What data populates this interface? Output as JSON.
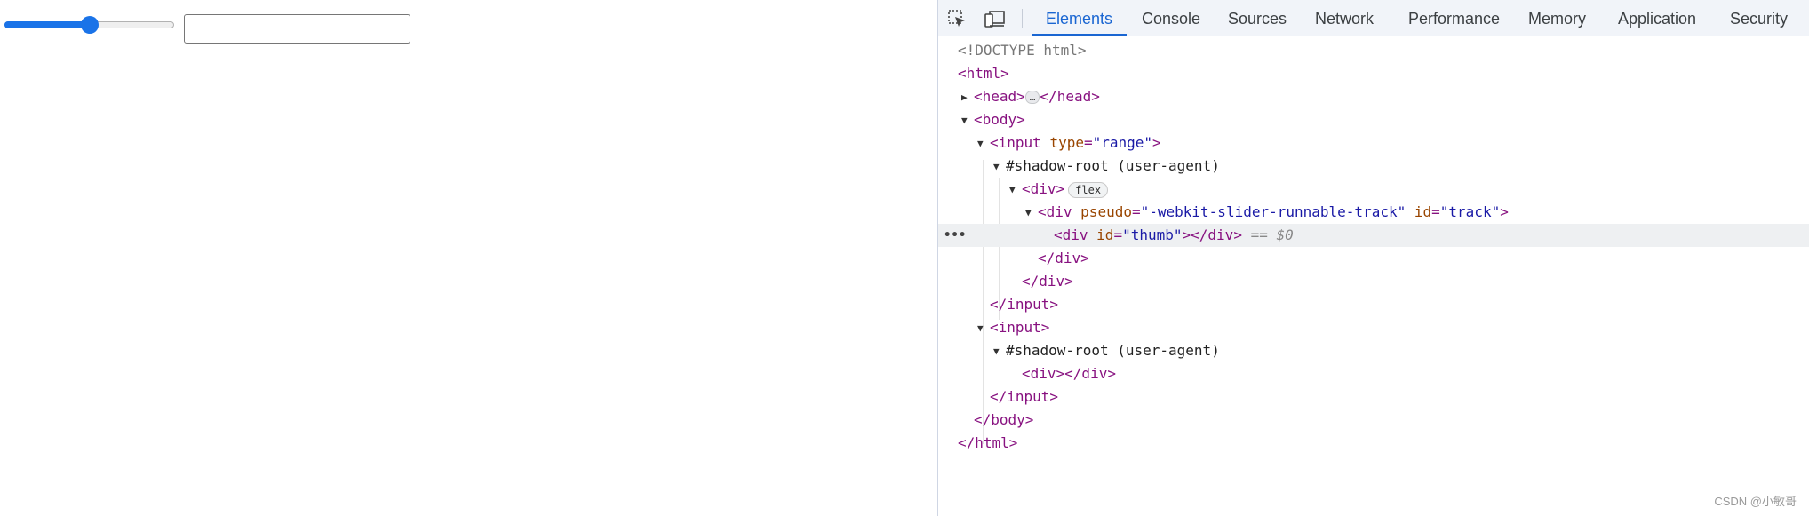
{
  "page": {
    "slider": {
      "value": 0.5
    }
  },
  "devtools": {
    "tabs": [
      "Elements",
      "Console",
      "Sources",
      "Network",
      "Performance",
      "Memory",
      "Application",
      "Security"
    ],
    "active_tab": "Elements",
    "tree": {
      "doctype": "<!DOCTYPE html>",
      "html_open": "<html>",
      "head_open": "<head>",
      "ellipsis": "…",
      "head_close": "</head>",
      "body_open": "<body>",
      "input_open": "<input",
      "type_attr": "type",
      "type_value": "\"range\"",
      "shadow_root": "#shadow-root (user-agent)",
      "div_open": "<div>",
      "flex_badge": "flex",
      "track_div_open": "<div",
      "pseudo_attr": "pseudo",
      "pseudo_value": "\"-webkit-slider-runnable-track\"",
      "id_attr": "id",
      "track_value": "\"track\"",
      "thumb_value": "\"thumb\"",
      "div_close": "</div>",
      "selected_marker": "== $0",
      "input_close": "</input>",
      "input_plain": "<input>",
      "empty_div": "<div></div>",
      "body_close": "</body>",
      "html_close": "</html>",
      "row_dots": "•••"
    },
    "watermark": "CSDN @小敏哥"
  }
}
